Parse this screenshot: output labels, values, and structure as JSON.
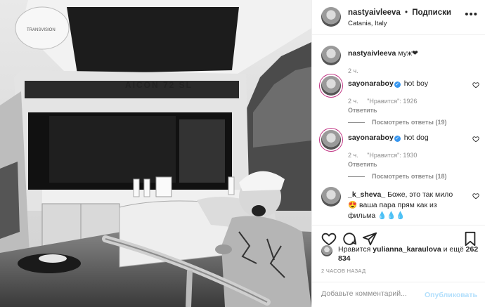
{
  "post": {
    "author": "nastyaivleeva",
    "separator": "•",
    "follow_label": "Подписки",
    "location": "Catania, Italy",
    "more_icon": "more-horizontal-icon",
    "photo_text": {
      "yacht_name": "AICON 72 SL",
      "dome_label": "TRANSVISION"
    }
  },
  "caption": {
    "username": "nastyaivleeva",
    "text": "муж❤",
    "time": "2 ч."
  },
  "comments": [
    {
      "username": "sayonaraboy",
      "verified": true,
      "text": "hot boy",
      "time": "2 ч.",
      "likes": "\"Нравится\": 1926",
      "reply_label": "Ответить",
      "view_replies": "Посмотреть ответы (19)"
    },
    {
      "username": "sayonaraboy",
      "verified": true,
      "text": "hot dog",
      "time": "2 ч.",
      "likes": "\"Нравится\": 1930",
      "reply_label": "Ответить",
      "view_replies": "Посмотреть ответы (18)"
    },
    {
      "username": "_k_sheva_",
      "verified": false,
      "text": "Боже, это так мило😍 ваша пара прям как из фильма 💧💧💧"
    }
  ],
  "actions": {
    "like_icon": "heart-icon",
    "comment_icon": "comment-icon",
    "share_icon": "share-icon",
    "save_icon": "bookmark-icon"
  },
  "likes": {
    "prefix": "Нравится ",
    "user": "yulianna_karaulova",
    "mid": " и ещё ",
    "count": "262 834"
  },
  "time_ago": "2 ЧАСОВ НАЗАД",
  "add_comment": {
    "placeholder": "Добавьте комментарий...",
    "post_label": "Опубликовать"
  }
}
